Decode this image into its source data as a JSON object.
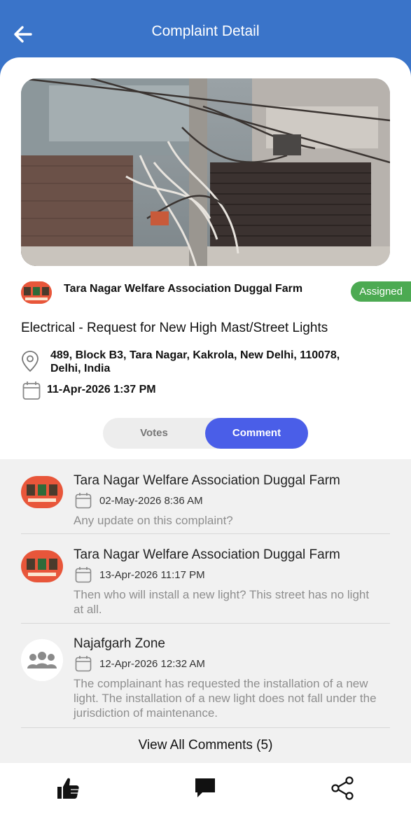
{
  "header": {
    "title": "Complaint Detail"
  },
  "complaint": {
    "org_name": "Tara Nagar Welfare Association  Duggal Farm",
    "status": "Assigned",
    "category": "Electrical - Request for New High Mast/Street Lights",
    "address": "489, Block B3, Tara Nagar, Kakrola, New Delhi, 110078, Delhi, India",
    "datetime": "11-Apr-2026 1:37 PM"
  },
  "tabs": {
    "votes": "Votes",
    "comment": "Comment",
    "active": "comment"
  },
  "comments": [
    {
      "author": "Tara Nagar Welfare Association  Duggal Farm",
      "date": "02-May-2026 8:36 AM",
      "text": "Any update on this complaint?",
      "avatar": "org-logo"
    },
    {
      "author": "Tara Nagar Welfare Association  Duggal Farm",
      "date": "13-Apr-2026 11:17 PM",
      "text": "Then who will install a new light? This street has no light at all.",
      "avatar": "org-logo"
    },
    {
      "author": "Najafgarh Zone",
      "date": "12-Apr-2026 12:32 AM",
      "text": "The complainant has requested the installation of a new light. The installation of a new light does not fall under the jurisdiction of maintenance.",
      "avatar": "people-group-icon"
    }
  ],
  "view_all_label": "View All Comments (5)",
  "bottom_bar": {
    "icons": [
      "thumbs-up-icon",
      "comment-icon",
      "share-icon"
    ]
  },
  "colors": {
    "primary": "#3a74c9",
    "accent": "#4a5ee8",
    "status_green": "#4caa52"
  }
}
